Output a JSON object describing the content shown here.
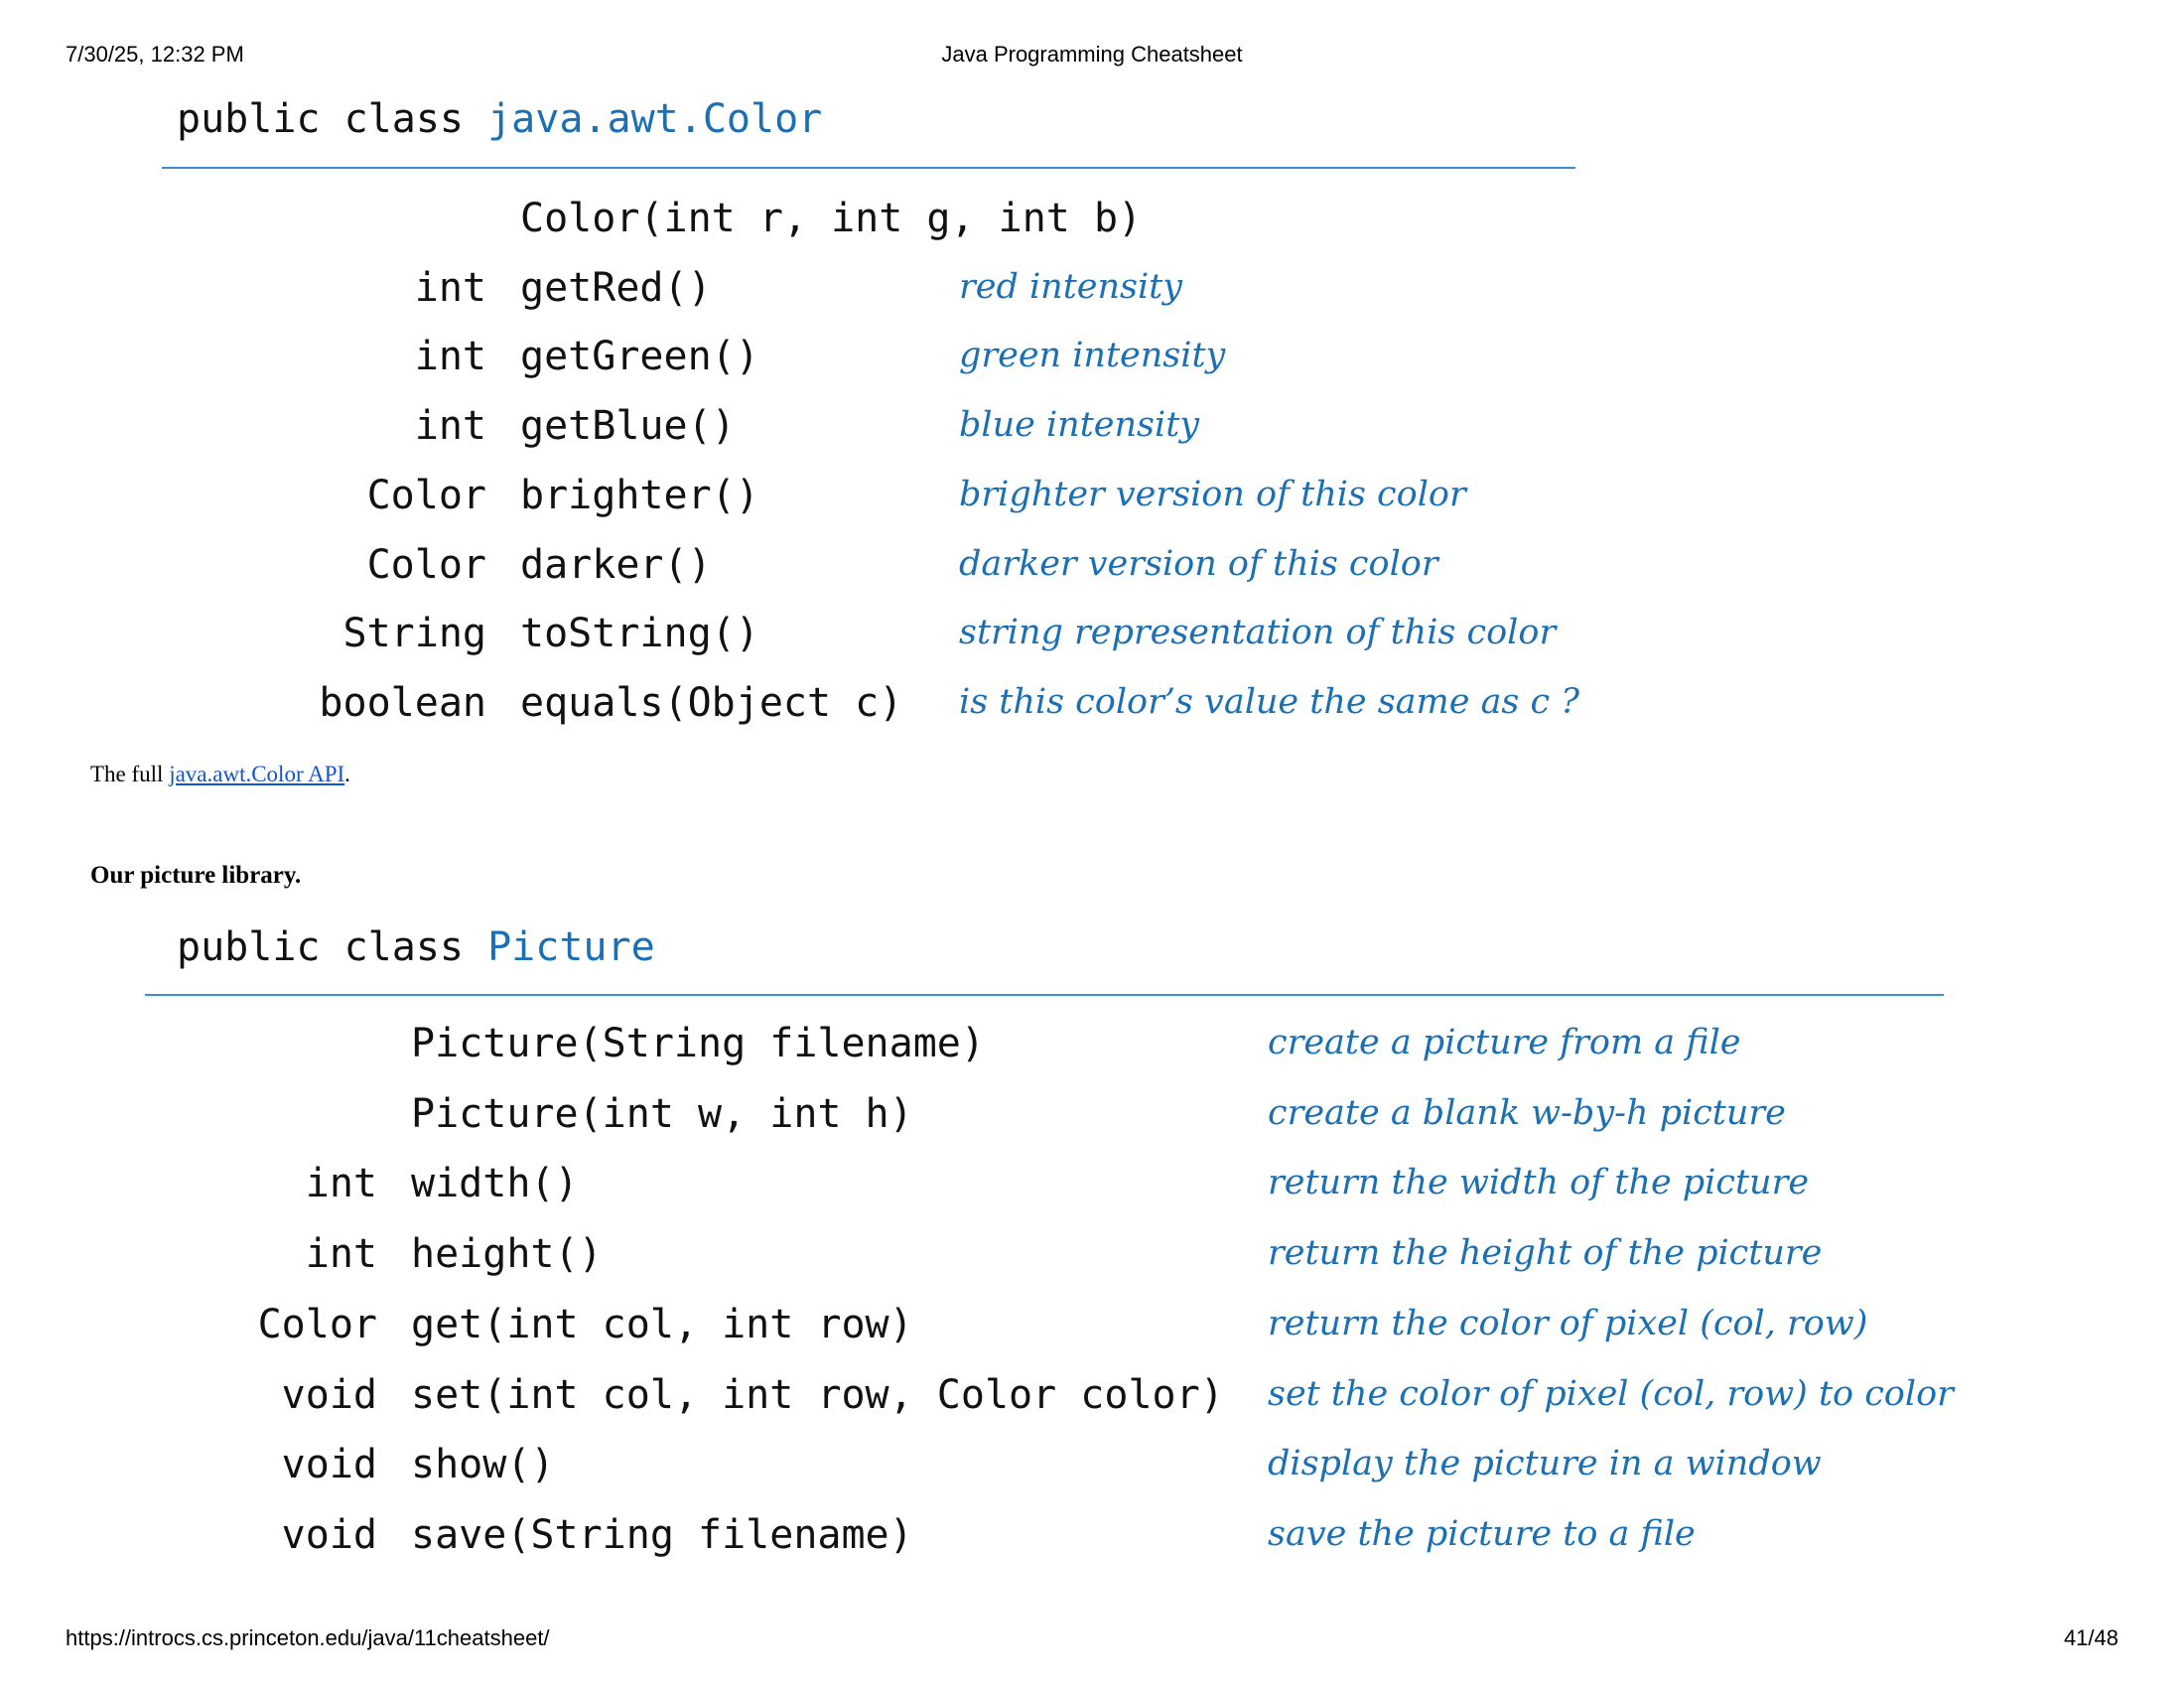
{
  "print_header": {
    "datetime": "7/30/25, 12:32 PM",
    "title": "Java Programming Cheatsheet"
  },
  "print_footer": {
    "url": "https://introcs.cs.princeton.edu/java/11cheatsheet/",
    "page": "41/48"
  },
  "color_api": {
    "keyword": "public class",
    "class_name": "java.awt.Color",
    "rows": [
      {
        "ret": "",
        "sig": "Color(int r, int g, int b)",
        "desc": ""
      },
      {
        "ret": "int",
        "sig": "getRed()",
        "desc": "red intensity"
      },
      {
        "ret": "int",
        "sig": "getGreen()",
        "desc": "green intensity"
      },
      {
        "ret": "int",
        "sig": "getBlue()",
        "desc": "blue intensity"
      },
      {
        "ret": "Color",
        "sig": "brighter()",
        "desc": "brighter version of this color"
      },
      {
        "ret": "Color",
        "sig": "darker()",
        "desc": "darker version of this color"
      },
      {
        "ret": "String",
        "sig": "toString()",
        "desc": "string representation of this color"
      },
      {
        "ret": "boolean",
        "sig": "equals(Object c)",
        "desc": "is this color’s value the same as c ?"
      }
    ]
  },
  "full_api_text": {
    "prefix": "The full ",
    "link": "java.awt.Color API",
    "suffix": "."
  },
  "picture_heading": "Our picture library.",
  "picture_api": {
    "keyword": "public class",
    "class_name": "Picture",
    "rows": [
      {
        "ret": "",
        "sig": "Picture(String filename)",
        "desc": "create a picture from a file"
      },
      {
        "ret": "",
        "sig": "Picture(int w, int h)",
        "desc": "create a blank w-by-h picture"
      },
      {
        "ret": "int",
        "sig": "width()",
        "desc": "return the width of the picture"
      },
      {
        "ret": "int",
        "sig": "height()",
        "desc": "return the height of the picture"
      },
      {
        "ret": "Color",
        "sig": "get(int col, int row)",
        "desc": "return the color of pixel (col, row)"
      },
      {
        "ret": "void",
        "sig": "set(int col, int row, Color color)",
        "desc": "set the color of pixel (col, row) to color"
      },
      {
        "ret": "void",
        "sig": "show()",
        "desc": "display the picture in a window"
      },
      {
        "ret": "void",
        "sig": "save(String filename)",
        "desc": "save the picture to a file"
      }
    ]
  },
  "colors": {
    "accent_blue": "#1a6fb5",
    "rule_blue": "#3a8fd0",
    "link_blue": "#1155cc"
  }
}
